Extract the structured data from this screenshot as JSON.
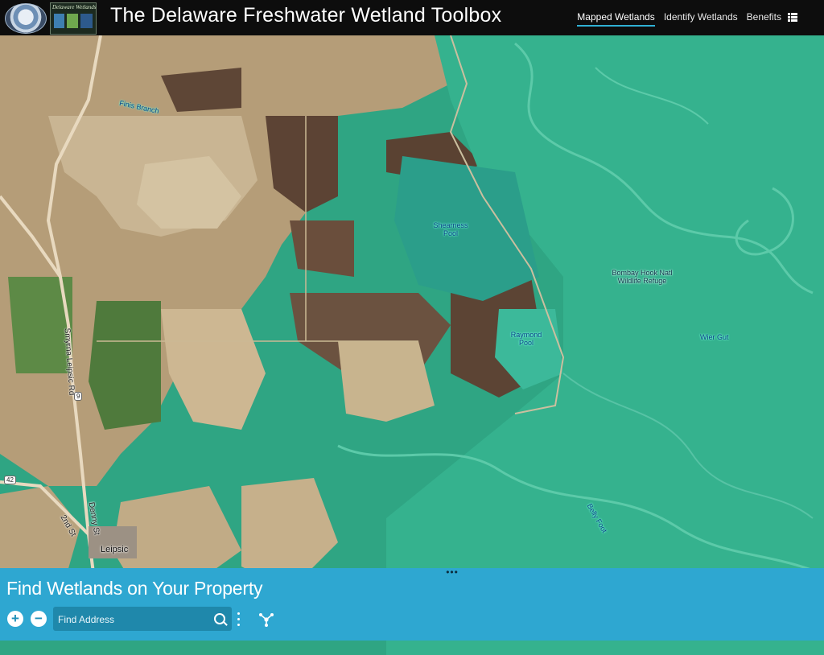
{
  "header": {
    "title": "The Delaware Freshwater Wetland Toolbox",
    "logo_text": "Delaware Wetlands",
    "nav": [
      {
        "label": "Mapped Wetlands",
        "active": true
      },
      {
        "label": "Identify Wetlands",
        "active": false
      },
      {
        "label": "Benefits",
        "active": false
      }
    ],
    "menu_icon": "list-menu-icon"
  },
  "map": {
    "labels": {
      "finis_branch": "Finis Branch",
      "shearness_pool": "Shearness Pool",
      "bombay_hook": "Bombay Hook Natl Wildlife Refuge",
      "raymond_pool": "Raymond Pool",
      "wier_gut": "Wier Gut",
      "smyrna_leipsic_rd": "Smyrna Leipsic Rd",
      "route_9": "9",
      "route_42": "42",
      "denny_st": "Denny St",
      "second_st": "2nd St",
      "leipsic": "Leipsic",
      "belly_foot": "Belly Foot"
    },
    "colors": {
      "wetland": "#2fae86",
      "farmland": "#b9a07a",
      "water_channel": "#55c8b0"
    }
  },
  "panel": {
    "title": "Find Wetlands on Your Property",
    "search_placeholder": "Find Address",
    "zoom_in": "+",
    "zoom_out": "−",
    "grip": "•••"
  }
}
